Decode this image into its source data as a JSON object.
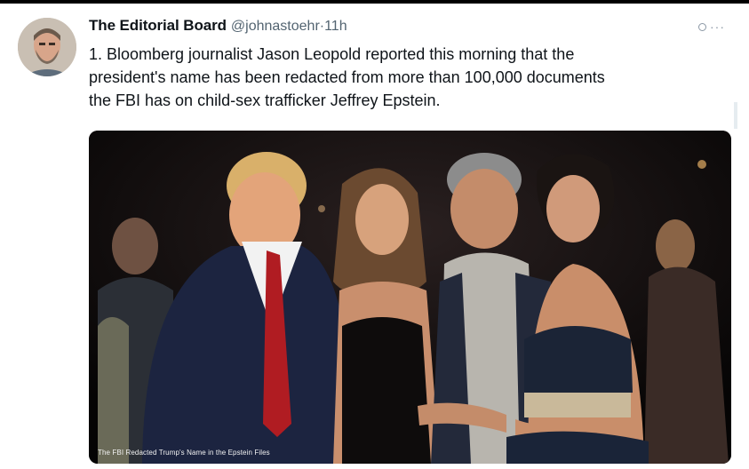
{
  "tweet": {
    "display_name": "The Editorial Board",
    "handle_time": "@johnastoehr·11h",
    "text": "1. Bloomberg journalist Jason Leopold reported this morning that the\npresident's name has been redacted from more than 100,000 documents\nthe FBI has on child-sex trafficker Jeffrey Epstein.",
    "image_caption": "The FBI Redacted Trump's Name in the Epstein Files"
  },
  "icons": {
    "avatar": "avatar",
    "more": "more-options-icon"
  },
  "colors": {
    "text": "#0f1419",
    "secondary": "#536471",
    "border": "#000000"
  }
}
